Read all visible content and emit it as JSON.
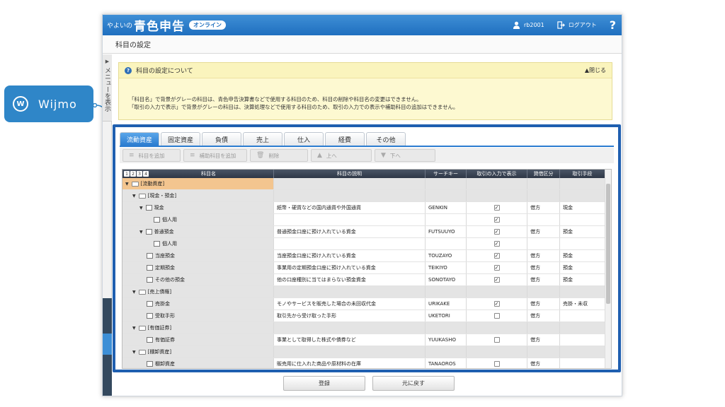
{
  "callout": {
    "label": "Wijmo"
  },
  "header": {
    "brand_prefix": "やよいの",
    "brand_main": "青色申告",
    "brand_badge": "オンライン",
    "user": "rb2001",
    "logout": "ログアウト",
    "help": "?"
  },
  "page_title": "科目の設定",
  "sidebar": {
    "label": "メニューを表示"
  },
  "info": {
    "title": "科目の設定について",
    "close": "▲閉じる",
    "line1": "「科目名」で背景がグレーの科目は、青色申告決算書などで使用する科目のため、科目の削除や科目名の変更はできません。",
    "line2": "「取引の入力で表示」で背景がグレーの科目は、決算処理などで使用する科目のため、取引の入力での表示や補助科目の追加はできません。"
  },
  "tabs": [
    "流動資産",
    "固定資産",
    "負債",
    "売上",
    "仕入",
    "経費",
    "その他"
  ],
  "toolbar": {
    "add_account": "科目を追加",
    "add_sub": "補助科目を追加",
    "delete": "削除",
    "up": "上へ",
    "down": "下へ"
  },
  "grid": {
    "levels": [
      "1",
      "2",
      "3",
      "4"
    ],
    "columns": [
      "科目名",
      "科目の説明",
      "サーチキー",
      "取引の入力で表示",
      "貸借区分",
      "取引手段"
    ],
    "rows": [
      {
        "name": "[流動資産]",
        "desc": "",
        "key": "",
        "show": "",
        "side": "",
        "means": ""
      },
      {
        "name": "[現金・預金]",
        "desc": "",
        "key": "",
        "show": "",
        "side": "",
        "means": ""
      },
      {
        "name": "現金",
        "desc": "紙幣・硬貨などの国内通貨や外国通貨",
        "key": "GENKIN",
        "show": "checked",
        "side": "借方",
        "means": "現金"
      },
      {
        "name": "個人用",
        "desc": "",
        "key": "",
        "show": "checked",
        "side": "",
        "means": ""
      },
      {
        "name": "普通預金",
        "desc": "普通預金口座に預け入れている資金",
        "key": "FUTSUUYO",
        "show": "checked",
        "side": "借方",
        "means": "預金"
      },
      {
        "name": "個人用",
        "desc": "",
        "key": "",
        "show": "checked",
        "side": "",
        "means": ""
      },
      {
        "name": "当座預金",
        "desc": "当座預金口座に預け入れている資金",
        "key": "TOUZAYO",
        "show": "checked",
        "side": "借方",
        "means": "預金"
      },
      {
        "name": "定期預金",
        "desc": "事業用の定期預金口座に預け入れている資金",
        "key": "TEIKIYO",
        "show": "checked",
        "side": "借方",
        "means": "預金"
      },
      {
        "name": "その他の預金",
        "desc": "他の口座種別に当てはまらない預金資金",
        "key": "SONOTAYO",
        "show": "checked",
        "side": "借方",
        "means": "預金"
      },
      {
        "name": "[売上債権]",
        "desc": "",
        "key": "",
        "show": "",
        "side": "",
        "means": ""
      },
      {
        "name": "売掛金",
        "desc": "モノやサービスを販売した場合の未回収代金",
        "key": "URIKAKE",
        "show": "checked",
        "side": "借方",
        "means": "売掛・未収"
      },
      {
        "name": "受取手形",
        "desc": "取引先から受け取った手形",
        "key": "UKETORI",
        "show": "unchecked",
        "side": "借方",
        "means": ""
      },
      {
        "name": "[有価証券]",
        "desc": "",
        "key": "",
        "show": "",
        "side": "",
        "means": ""
      },
      {
        "name": "有価証券",
        "desc": "事業として取得した株式や債券など",
        "key": "YUUKASHO",
        "show": "unchecked",
        "side": "借方",
        "means": ""
      },
      {
        "name": "[棚卸資産]",
        "desc": "",
        "key": "",
        "show": "",
        "side": "",
        "means": ""
      },
      {
        "name": "棚卸資産",
        "desc": "販売用に仕入れた商品や原材料の在庫",
        "key": "TANAOROS",
        "show": "unchecked",
        "side": "借方",
        "means": ""
      }
    ]
  },
  "footer": {
    "register": "登録",
    "reset": "元に戻す"
  }
}
